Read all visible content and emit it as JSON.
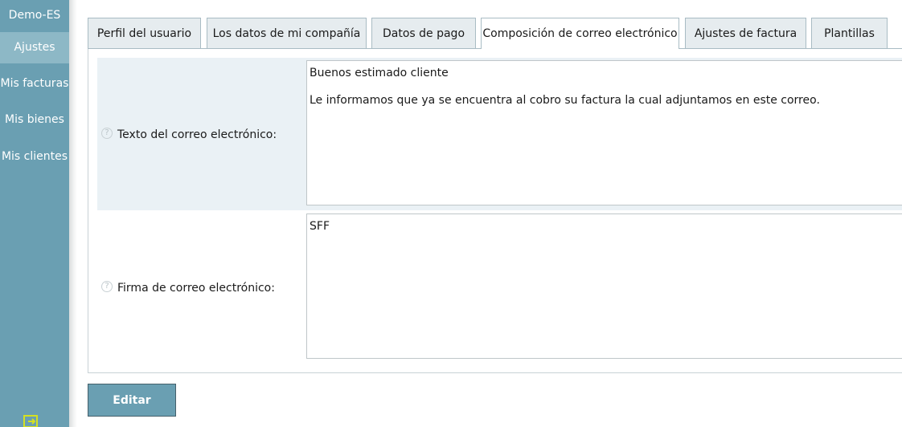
{
  "sidebar": {
    "items": [
      {
        "label": "Demo-ES"
      },
      {
        "label": "Ajustes"
      },
      {
        "label": "Mis facturas"
      },
      {
        "label": "Mis bienes"
      },
      {
        "label": "Mis clientes"
      }
    ],
    "active_index": 1,
    "exit_icon": "exit-icon"
  },
  "tabs": [
    {
      "label": "Perfil del usuario"
    },
    {
      "label": "Los datos de mi compañía"
    },
    {
      "label": "Datos de pago"
    },
    {
      "label": "Composición de correo electrónico"
    },
    {
      "label": "Ajustes de factura"
    },
    {
      "label": "Plantillas"
    }
  ],
  "active_tab": 3,
  "form": {
    "email_text": {
      "label": "Texto del correo electrónico:",
      "lines": [
        "Buenos estimado cliente",
        "Le informamos que ya se encuentra al cobro su factura la cual adjuntamos en este correo."
      ]
    },
    "signature": {
      "label": "Firma de correo electrónico:",
      "value": "SFF"
    }
  },
  "edit_button": {
    "label": "Editar"
  },
  "colors": {
    "sidebar": "#6a9fb2",
    "sidebar_active": "#8db8c6",
    "row_highlight": "#eaf1f5",
    "button": "#6a9fb2",
    "exit_icon": "#d4e021"
  }
}
